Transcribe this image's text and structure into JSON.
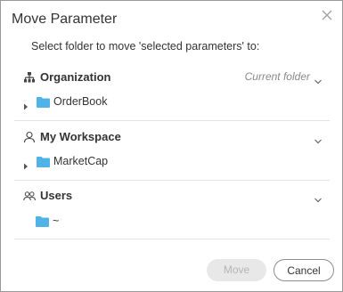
{
  "dialog": {
    "title": "Move Parameter",
    "subtitle": "Select folder to move 'selected parameters' to:"
  },
  "sections": [
    {
      "title": "Organization",
      "icon": "org-tree-icon",
      "current_label": "Current folder",
      "folders": [
        {
          "label": "OrderBook",
          "expandable": true
        }
      ]
    },
    {
      "title": "My Workspace",
      "icon": "user-icon",
      "folders": [
        {
          "label": "MarketCap",
          "expandable": true
        }
      ]
    },
    {
      "title": "Users",
      "icon": "users-icon",
      "folders": [
        {
          "label": "~",
          "expandable": false
        }
      ]
    }
  ],
  "buttons": {
    "move_label": "Move",
    "move_disabled": true,
    "cancel_label": "Cancel"
  },
  "colors": {
    "folder": "#4fb3e8",
    "divider": "#e3e3e3",
    "muted": "#8a8a8a"
  }
}
